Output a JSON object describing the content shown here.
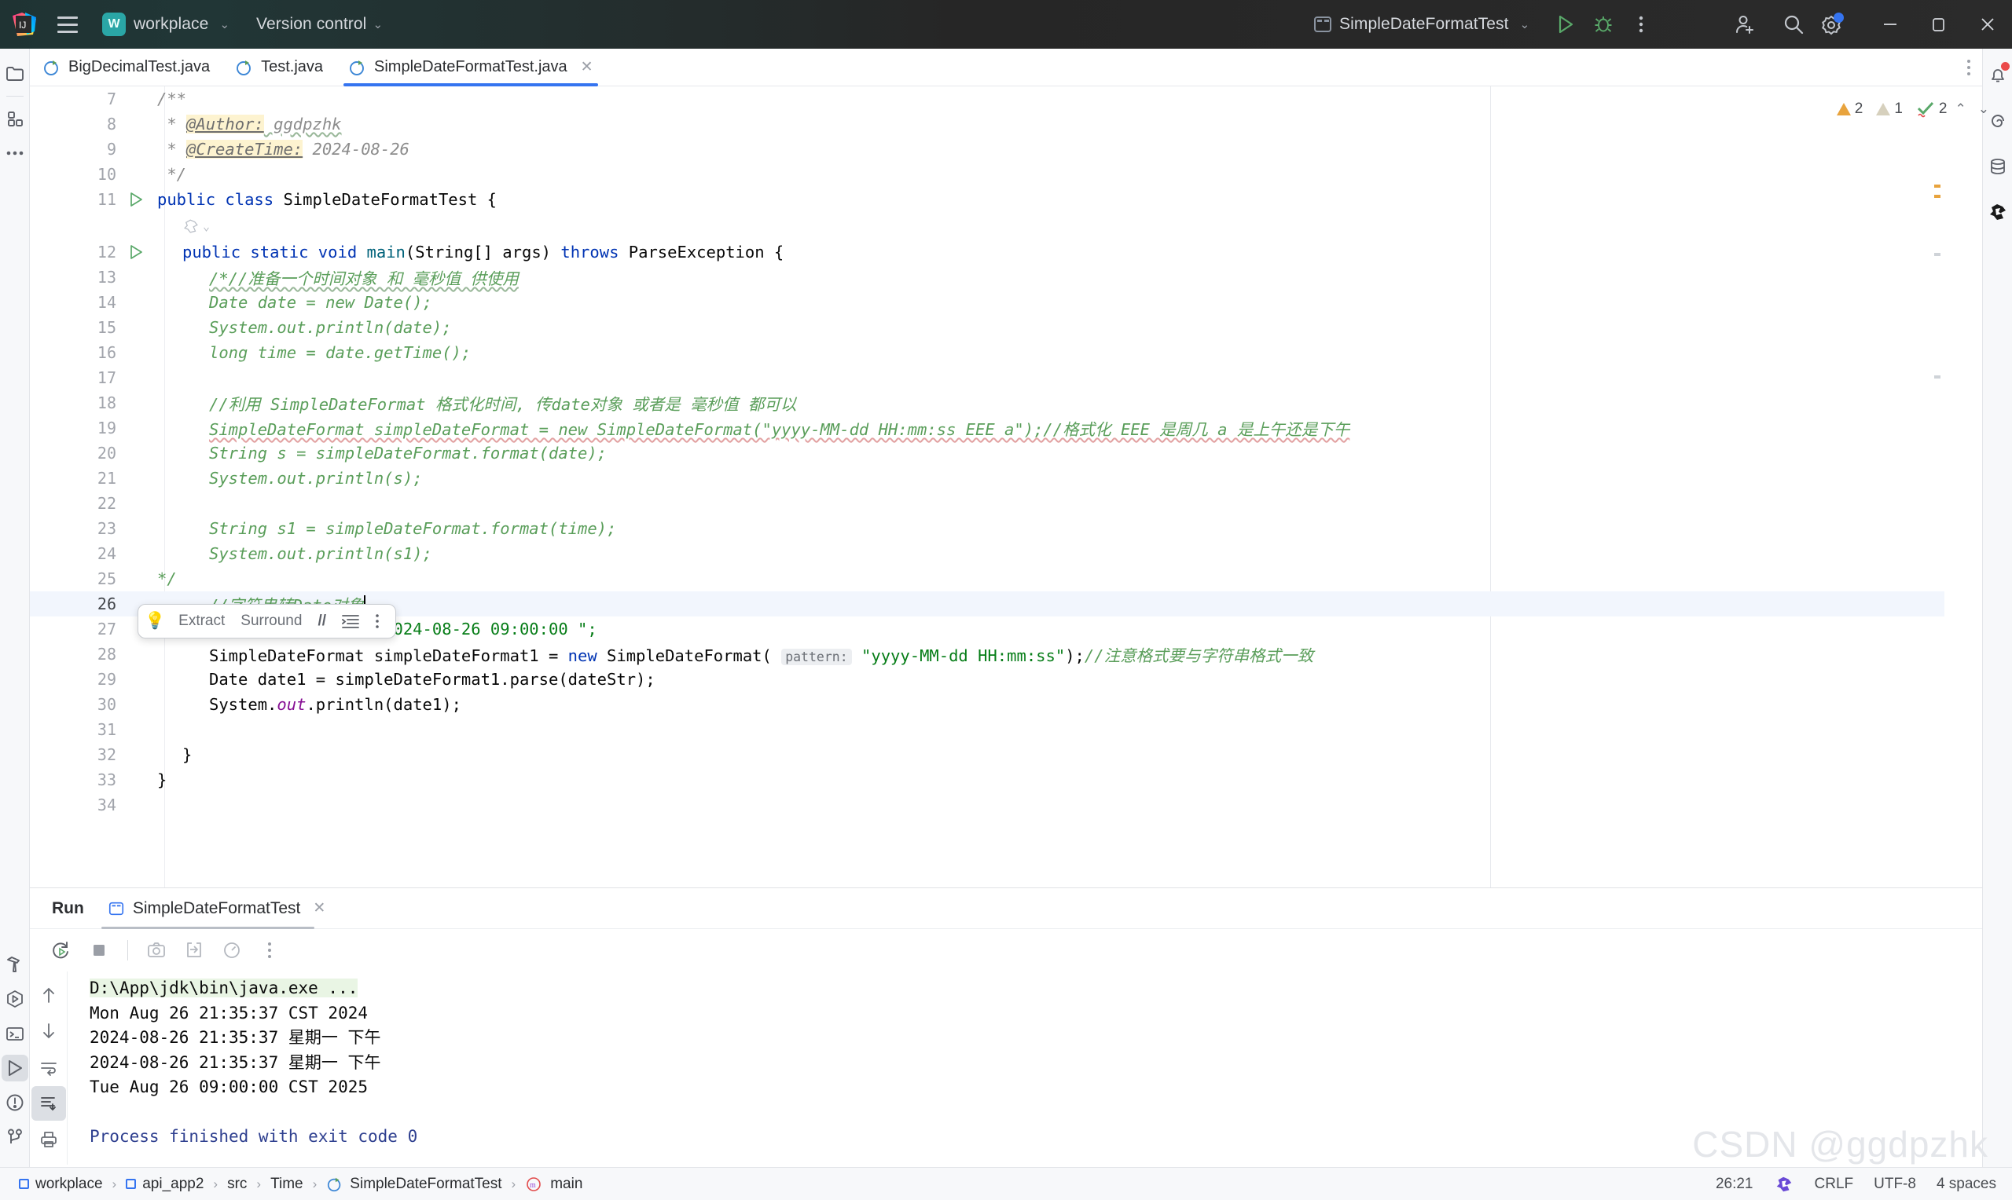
{
  "titlebar": {
    "menu_icon": "hamburger-icon",
    "project_badge": "W",
    "project_name": "workplace",
    "version_control": "Version control",
    "run_config": "SimpleDateFormatTest",
    "run_icon": "run-icon",
    "debug_icon": "debug-icon",
    "more_icon": "more-vertical-icon",
    "account_icon": "account-add-icon",
    "search_icon": "search-icon",
    "settings_icon": "settings-gear-icon",
    "minimize": "minimize-icon",
    "maximize": "maximize-icon",
    "close": "close-icon"
  },
  "left_rail": [
    {
      "name": "project-tool-icon",
      "label": "Project"
    },
    {
      "name": "structure-tool-icon",
      "label": "Structure"
    },
    {
      "name": "more-tool-icon",
      "label": "More"
    },
    {
      "name": "build-hammer-icon",
      "label": "Build"
    },
    {
      "name": "run-hex-icon",
      "label": "Run Anything"
    },
    {
      "name": "terminal-icon",
      "label": "Terminal"
    },
    {
      "name": "run-tool-icon",
      "label": "Run"
    },
    {
      "name": "problems-icon",
      "label": "Problems"
    },
    {
      "name": "version-control-branch-icon",
      "label": "Git"
    }
  ],
  "right_rail": [
    {
      "name": "notifications-bell-icon",
      "label": "Notifications",
      "badge": true
    },
    {
      "name": "ai-assistant-icon",
      "label": "AI Assistant"
    },
    {
      "name": "database-icon",
      "label": "Database"
    },
    {
      "name": "maven-icon",
      "label": "Maven"
    }
  ],
  "editor_tabs": [
    {
      "label": "BigDecimalTest.java",
      "selected": false,
      "closable": false
    },
    {
      "label": "Test.java",
      "selected": false,
      "closable": false
    },
    {
      "label": "SimpleDateFormatTest.java",
      "selected": true,
      "closable": true
    }
  ],
  "inspections": {
    "warnings": "2",
    "weak_warnings": "1",
    "typos": "2",
    "up_icon": "chevron-up-icon",
    "down_icon": "chevron-down-icon"
  },
  "intention_popup": {
    "bulb_icon": "lightbulb-icon",
    "extract": "Extract",
    "surround": "Surround",
    "comment": "//",
    "list_icon": "indent-list-icon",
    "more_icon": "more-vertical-icon"
  },
  "code_lines": [
    {
      "n": "7",
      "indent": 0
    },
    {
      "n": "8",
      "indent": 0
    },
    {
      "n": "9",
      "indent": 0
    },
    {
      "n": "10",
      "indent": 0
    },
    {
      "n": "11",
      "indent": 0,
      "gutter": "run-arrow"
    },
    {
      "n": "12",
      "indent": 0,
      "gutter": "run-arrow"
    },
    {
      "n": "13",
      "indent": 0
    },
    {
      "n": "14",
      "indent": 0
    },
    {
      "n": "15",
      "indent": 0
    },
    {
      "n": "16",
      "indent": 0
    },
    {
      "n": "17",
      "indent": 0
    },
    {
      "n": "18",
      "indent": 0
    },
    {
      "n": "19",
      "indent": 0
    },
    {
      "n": "20",
      "indent": 0
    },
    {
      "n": "21",
      "indent": 0
    },
    {
      "n": "22",
      "indent": 0
    },
    {
      "n": "23",
      "indent": 0
    },
    {
      "n": "24",
      "indent": 0
    },
    {
      "n": "25",
      "indent": 0
    },
    {
      "n": "26",
      "indent": 0,
      "current": true
    },
    {
      "n": "27",
      "indent": 0
    },
    {
      "n": "28",
      "indent": 0
    },
    {
      "n": "29",
      "indent": 0
    },
    {
      "n": "30",
      "indent": 0
    },
    {
      "n": "31",
      "indent": 0
    },
    {
      "n": "32",
      "indent": 0
    },
    {
      "n": "33",
      "indent": 0
    },
    {
      "n": "34",
      "indent": 0
    }
  ],
  "code_text": {
    "l7": "/**",
    "l8_star": " * ",
    "l8_tag": "@Author:",
    "l8_val": " ggdpzhk",
    "l9_star": " * ",
    "l9_tag": "@CreateTime:",
    "l9_val": " 2024-08-26",
    "l10": " */",
    "l11_kw1": "public",
    "l11_kw2": "class",
    "l11_name": "SimpleDateFormatTest {",
    "l12": "public static void main(String[] args) throws ParseException {",
    "l12_kw1": "public static void",
    "l12_mid": "main",
    "l12_args": "(String[] args) ",
    "l12_kw2": "throws",
    "l12_tail": " ParseException {",
    "l13": "/*//准备一个时间对象 和 毫秒值 供使用",
    "l14": "Date date = new Date();",
    "l15": "System.out.println(date);",
    "l16": "long time = date.getTime();",
    "l17": "",
    "l18": "//利用 SimpleDateFormat 格式化时间, 传date对象 或者是 毫秒值 都可以",
    "l19": "SimpleDateFormat simpleDateFormat = new SimpleDateFormat(\"yyyy-MM-dd HH:mm:ss EEE a\");//格式化 EEE 是周几 a 是上午还是下午",
    "l20": "String s = simpleDateFormat.format(date);",
    "l21": "System.out.println(s);",
    "l22": "",
    "l23": "String s1 = simpleDateFormat.format(time);",
    "l24": "System.out.println(s1);",
    "l25": "*/",
    "l26": "//字符串转Date对象",
    "l27_pre": "String dateStr = \"2024-08",
    "l27_post": "-26 09:00:00 \";",
    "l28_pre": "SimpleDateFormat simpleDateFormat1 = ",
    "l28_new": "new",
    "l28_mid": " SimpleDateFormat( ",
    "l28_hint": "pattern:",
    "l28_str": " \"yyyy-MM-dd HH:mm:ss\"",
    "l28_tail": ");",
    "l28_cmt": "//注意格式要与字符串格式一致",
    "l29": "Date date1 = simpleDateFormat1.parse(dateStr);",
    "l30_pre": "System.",
    "l30_out": "out",
    "l30_post": ".println(date1);",
    "l31": "",
    "l32": "}",
    "l33": "}",
    "l34": ""
  },
  "run_panel": {
    "title": "Run",
    "tab_label": "SimpleDateFormatTest",
    "tab_close": "close-icon",
    "toolbar": [
      {
        "name": "rerun-icon",
        "label": "Rerun"
      },
      {
        "name": "stop-icon",
        "label": "Stop"
      },
      {
        "name": "screenshot-camera-icon",
        "label": "Screenshot"
      },
      {
        "name": "export-icon",
        "label": "Export"
      },
      {
        "name": "profiler-icon",
        "label": "Profiler"
      },
      {
        "name": "more-vertical-icon",
        "label": "More"
      }
    ],
    "console_rail": [
      {
        "name": "scroll-up-icon",
        "label": "Up"
      },
      {
        "name": "scroll-down-icon",
        "label": "Down"
      },
      {
        "name": "soft-wrap-icon",
        "label": "Soft-Wrap"
      },
      {
        "name": "scroll-to-end-icon",
        "label": "Scroll to End",
        "active": true
      },
      {
        "name": "print-icon",
        "label": "Print"
      }
    ],
    "console_lines": [
      {
        "text": "D:\\App\\jdk\\bin\\java.exe ...",
        "style": "cmd"
      },
      {
        "text": "Mon Aug 26 21:35:37 CST 2024",
        "style": "out"
      },
      {
        "text": "2024-08-26 21:35:37 星期一 下午",
        "style": "out"
      },
      {
        "text": "2024-08-26 21:35:37 星期一 下午",
        "style": "out"
      },
      {
        "text": "Tue Aug 26 09:00:00 CST 2025",
        "style": "out"
      },
      {
        "text": "",
        "style": "out"
      },
      {
        "text": "Process finished with exit code 0",
        "style": "blue"
      }
    ]
  },
  "status_bar": {
    "breadcrumbs": [
      {
        "label": "workplace",
        "icon": "module-icon"
      },
      {
        "label": "api_app2",
        "icon": "module-icon"
      },
      {
        "label": "src",
        "icon": ""
      },
      {
        "label": "Time",
        "icon": ""
      },
      {
        "label": "SimpleDateFormatTest",
        "icon": "java-class-icon"
      },
      {
        "label": "main",
        "icon": "method-icon"
      }
    ],
    "separator": "›",
    "caret_position": "26:21",
    "ai_icon": "maven-icon",
    "line_separator": "CRLF",
    "encoding": "UTF-8",
    "indent": "4 spaces"
  },
  "watermark": "CSDN @ggdpzhk",
  "colors": {
    "accent_blue": "#3574f0",
    "keyword_blue": "#0033b3",
    "string_green": "#067d17",
    "comment_gray": "#8c8c8c",
    "comment_green": "#5a9e5a",
    "static_purple": "#871094",
    "titlebar_dark": "#262626",
    "run_green": "#59a869",
    "warning_orange": "#e8a33d"
  }
}
